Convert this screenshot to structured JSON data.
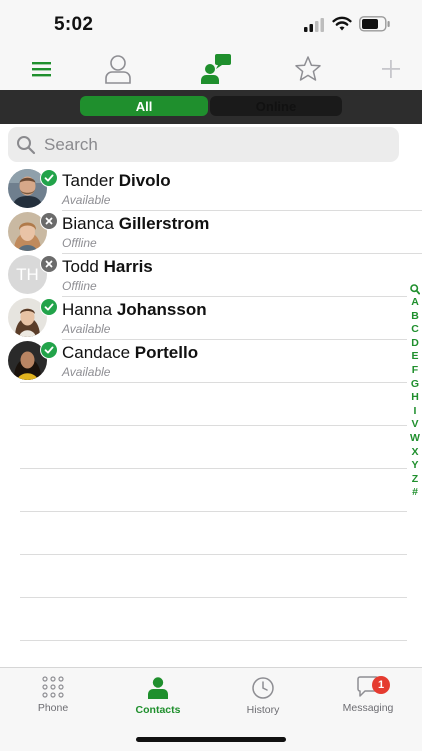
{
  "status_bar": {
    "time": "5:02"
  },
  "colors": {
    "accent": "#1f8f2d",
    "available": "#22a34a",
    "offline": "#6b6b6b",
    "badge": "#e53b30"
  },
  "nav": {
    "icons": [
      "hamburger-menu-icon",
      "contact-person-icon",
      "contact-chat-icon",
      "favorites-star-icon",
      "add-plus-icon"
    ]
  },
  "segmented": {
    "all_label": "All",
    "online_label": "Online",
    "selected": "All"
  },
  "search": {
    "placeholder": "Search"
  },
  "contacts": [
    {
      "first": "Tander",
      "last": "Divolo",
      "status": "Available",
      "presence": "available"
    },
    {
      "first": "Bianca",
      "last": "Gillerstrom",
      "status": "Offline",
      "presence": "offline"
    },
    {
      "first": "Todd",
      "last": "Harris",
      "status": "Offline",
      "presence": "offline",
      "initials": "TH"
    },
    {
      "first": "Hanna",
      "last": "Johansson",
      "status": "Available",
      "presence": "available"
    },
    {
      "first": "Candace",
      "last": "Portello",
      "status": "Available",
      "presence": "available"
    }
  ],
  "index_letters": [
    "A",
    "B",
    "C",
    "D",
    "E",
    "F",
    "G",
    "H",
    "I",
    "V",
    "W",
    "X",
    "Y",
    "Z",
    "#"
  ],
  "tabs": [
    {
      "label": "Phone",
      "icon": "dialpad-icon"
    },
    {
      "label": "Contacts",
      "icon": "contacts-icon",
      "active": true
    },
    {
      "label": "History",
      "icon": "clock-icon"
    },
    {
      "label": "Messaging",
      "icon": "chat-bubble-icon",
      "badge": "1"
    }
  ]
}
